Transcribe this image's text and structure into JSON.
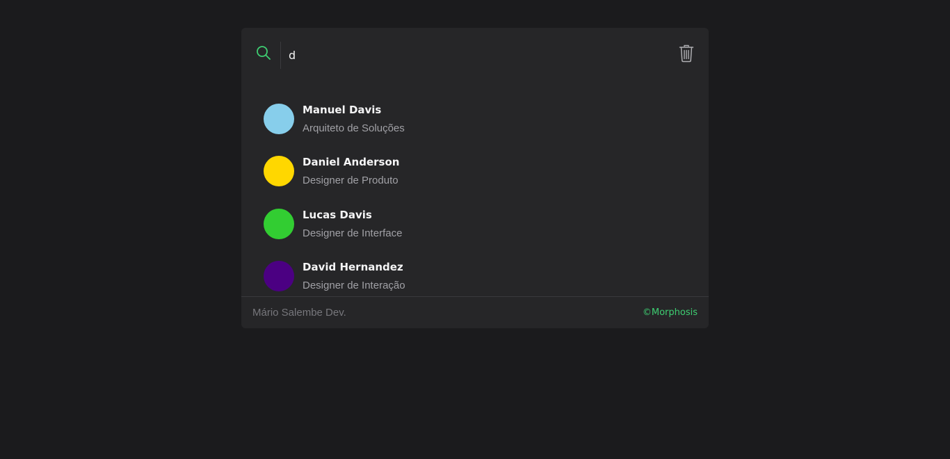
{
  "search": {
    "value": "d",
    "icon": "search-icon",
    "accent_color": "#3ecf72"
  },
  "clear": {
    "icon": "trash-icon"
  },
  "results": [
    {
      "name": "Manuel Davis",
      "role": "Arquiteto de Soluções",
      "avatar_color": "#87ceeb"
    },
    {
      "name": "Daniel Anderson",
      "role": "Designer de Produto",
      "avatar_color": "#ffd700"
    },
    {
      "name": "Lucas Davis",
      "role": "Designer de Interface",
      "avatar_color": "#32cd32"
    },
    {
      "name": "David Hernandez",
      "role": "Designer de Interação",
      "avatar_color": "#4b0082"
    }
  ],
  "footer": {
    "author": "Mário Salembe Dev.",
    "brand": "©Morphosis",
    "brand_color": "#3ecf72"
  }
}
